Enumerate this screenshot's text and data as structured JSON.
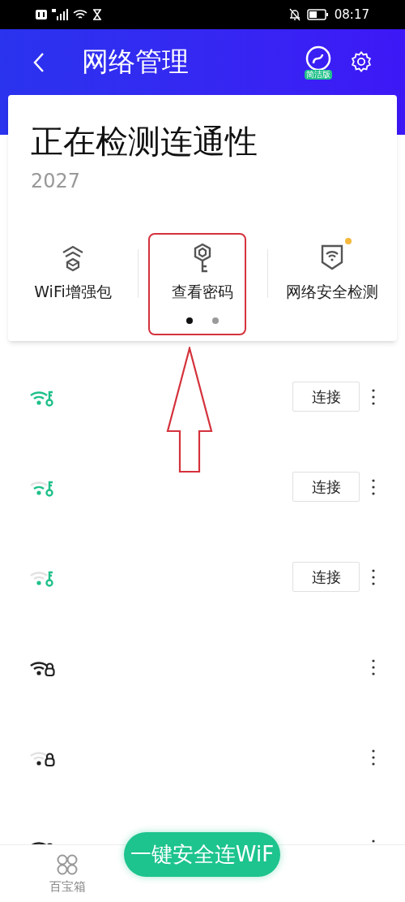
{
  "status_bar": {
    "time": "08:17"
  },
  "header": {
    "title": "网络管理",
    "edition_badge": "简洁版"
  },
  "card": {
    "title": "正在检测连通性",
    "subtitle": "2027",
    "features": [
      {
        "label": "WiFi增强包",
        "kind": "boost",
        "badge": false
      },
      {
        "label": "查看密码",
        "kind": "key",
        "badge": false
      },
      {
        "label": "网络安全检测",
        "kind": "shield",
        "badge": true
      }
    ],
    "pages": [
      {
        "selected": true
      },
      {
        "selected": false
      }
    ]
  },
  "networks": [
    {
      "kind": "shared",
      "connect_button": "连接"
    },
    {
      "kind": "shared",
      "connect_button": "连接"
    },
    {
      "kind": "shared",
      "connect_button": "连接"
    },
    {
      "kind": "locked"
    },
    {
      "kind": "locked"
    },
    {
      "kind": "locked"
    }
  ],
  "connect_fab": "一键安全连WiF",
  "bottom_nav": [
    {
      "label": "百宝箱"
    }
  ]
}
